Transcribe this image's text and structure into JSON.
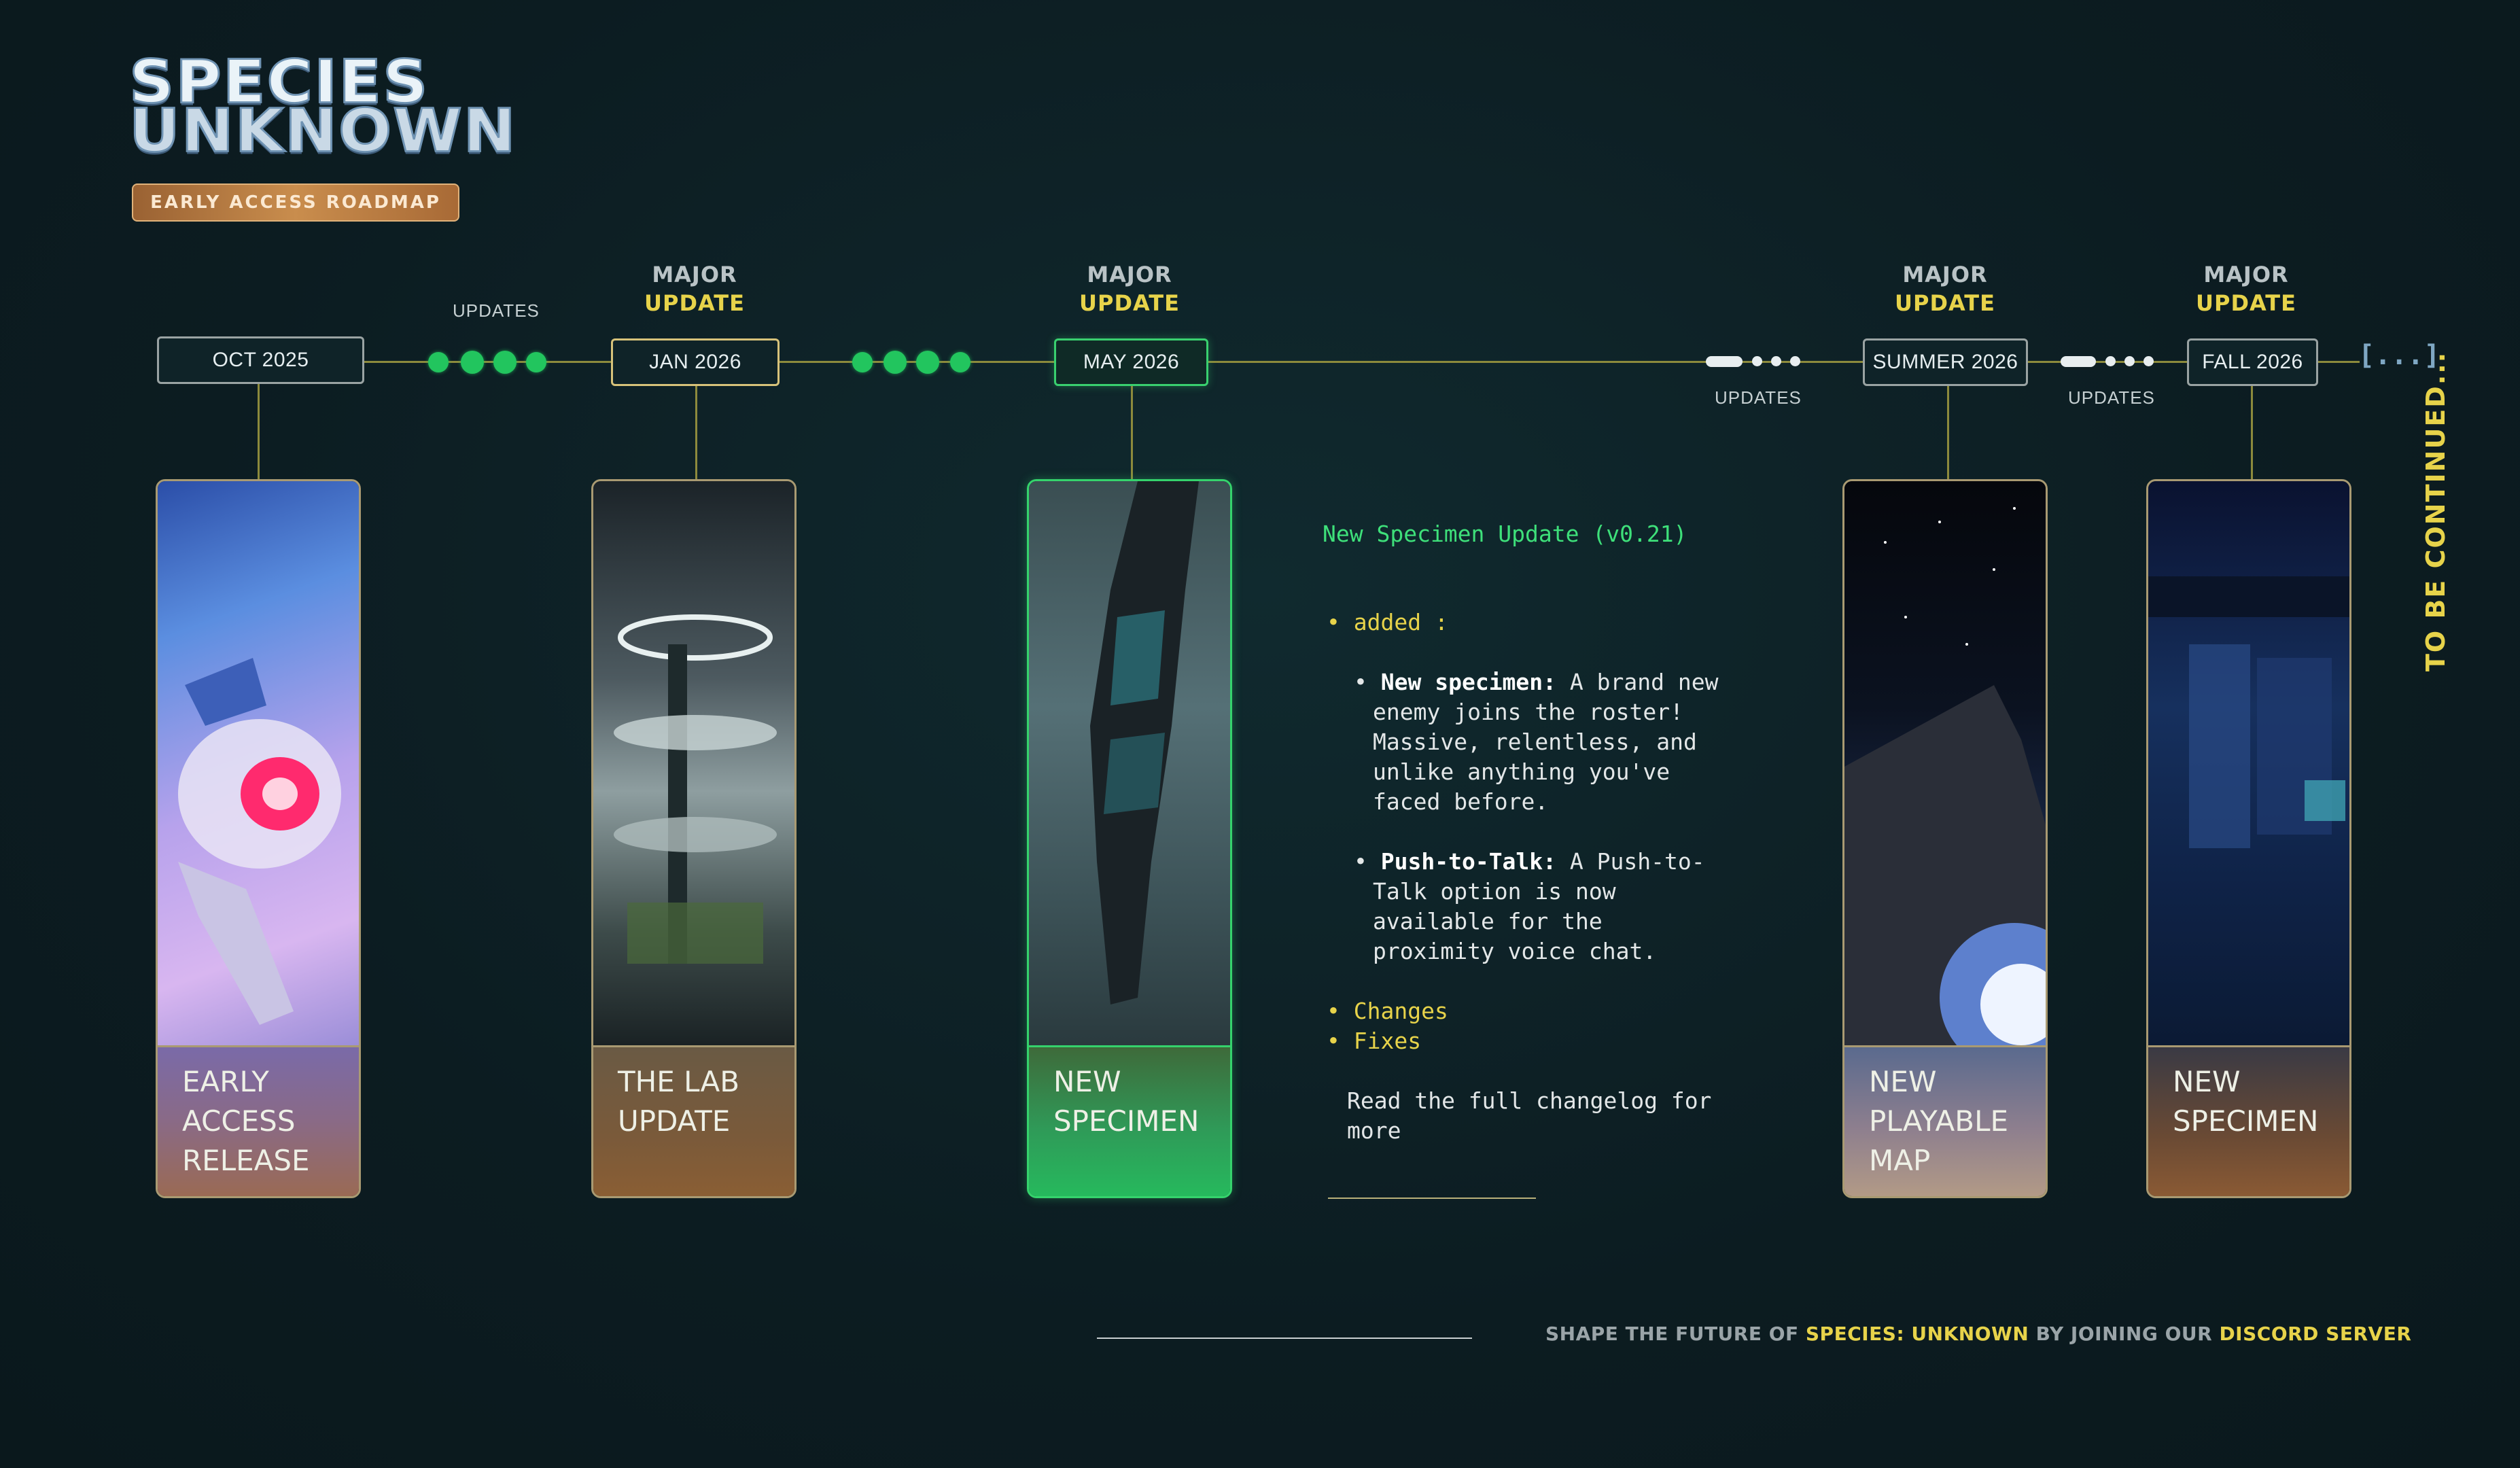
{
  "logo": {
    "line1": "SPECIES",
    "line2": "UNKNOWN",
    "badge": "EARLY ACCESS ROADMAP"
  },
  "timeline": {
    "dates": [
      "OCT 2025",
      "JAN 2026",
      "MAY 2026",
      "SUMMER 2026",
      "FALL 2026"
    ],
    "major_label": "MAJOR",
    "update_label": "UPDATE",
    "updates_label": "UPDATES",
    "ellipsis": "[...]",
    "to_be_continued": "TO BE CONTINUED..."
  },
  "cards": [
    {
      "line1": "EARLY",
      "line2": "ACCESS",
      "line3": "RELEASE"
    },
    {
      "line1": "THE LAB",
      "line2": "UPDATE"
    },
    {
      "line1": "NEW",
      "line2": "SPECIMEN"
    },
    {
      "line1": "NEW",
      "line2": "PLAYABLE",
      "line3": "MAP"
    },
    {
      "line1": "NEW",
      "line2": "SPECIMEN"
    }
  ],
  "changelog": {
    "title": "New Specimen Update (v0.21)",
    "added": "added :",
    "item1_bold": "New specimen:",
    "item1_l1": " A brand new",
    "item1_l2": "enemy joins the roster!",
    "item1_l3": "Massive, relentless, and",
    "item1_l4": "unlike anything you've",
    "item1_l5": "faced before.",
    "item2_bold": "Push-to-Talk:",
    "item2_l1": " A Push-to-",
    "item2_l2": "Talk option is now",
    "item2_l3": "available for the",
    "item2_l4": "proximity voice chat.",
    "changes": "Changes",
    "fixes": "Fixes",
    "read_l1": "Read the full changelog for",
    "read_l2": "more"
  },
  "footer": {
    "pre": "SHAPE THE FUTURE OF ",
    "game": "SPECIES: UNKNOWN",
    "mid": " BY JOINING OUR ",
    "discord": "DISCORD SERVER"
  },
  "colors": {
    "accent_yellow": "#e7d34a",
    "accent_green": "#22c55e",
    "background": "#0d1f24",
    "card_border": "#a99a72"
  }
}
